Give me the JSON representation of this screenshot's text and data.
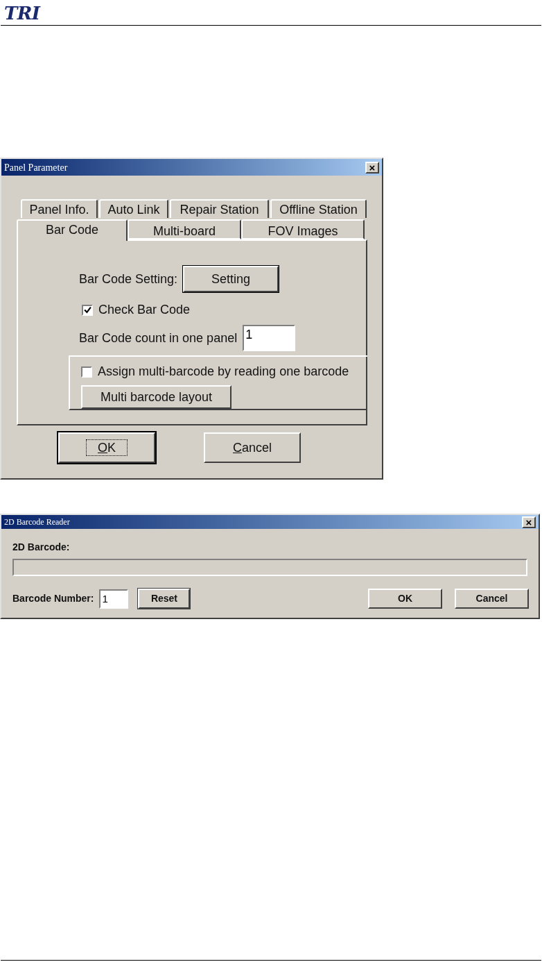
{
  "header": {
    "logo": "TRI"
  },
  "panel_parameter": {
    "title": "Panel Parameter",
    "close": "×",
    "tab_rows": [
      [
        {
          "label": "Panel Info.",
          "selected": false
        },
        {
          "label": "Auto Link",
          "selected": false
        },
        {
          "label": "Repair Station",
          "selected": false
        },
        {
          "label": "Offline Station",
          "selected": false
        }
      ],
      [
        {
          "label": "Bar Code",
          "selected": true
        },
        {
          "label": "Multi-board",
          "selected": false
        },
        {
          "label": "FOV Images",
          "selected": false
        }
      ]
    ],
    "setting_label": "Bar Code Setting:",
    "setting_button": "Setting",
    "check_bar_code": {
      "label": "Check Bar Code",
      "checked": true
    },
    "count_label": "Bar Code count in one panel",
    "count_value": "1",
    "assign_multi": {
      "label": "Assign multi-barcode by reading one barcode",
      "checked": false
    },
    "layout_button": "Multi barcode layout",
    "buttons": [
      {
        "label": "OK",
        "underline_first": true,
        "focused": true
      },
      {
        "label": "Cancel",
        "underline_first": true,
        "focused": false
      }
    ]
  },
  "barcode_reader": {
    "title": "2D Barcode Reader",
    "close": "×",
    "barcode_label": "2D Barcode:",
    "number_label": "Barcode Number:",
    "number_value": "1",
    "reset_button": "Reset",
    "buttons": [
      {
        "label": "OK"
      },
      {
        "label": "Cancel"
      }
    ]
  }
}
